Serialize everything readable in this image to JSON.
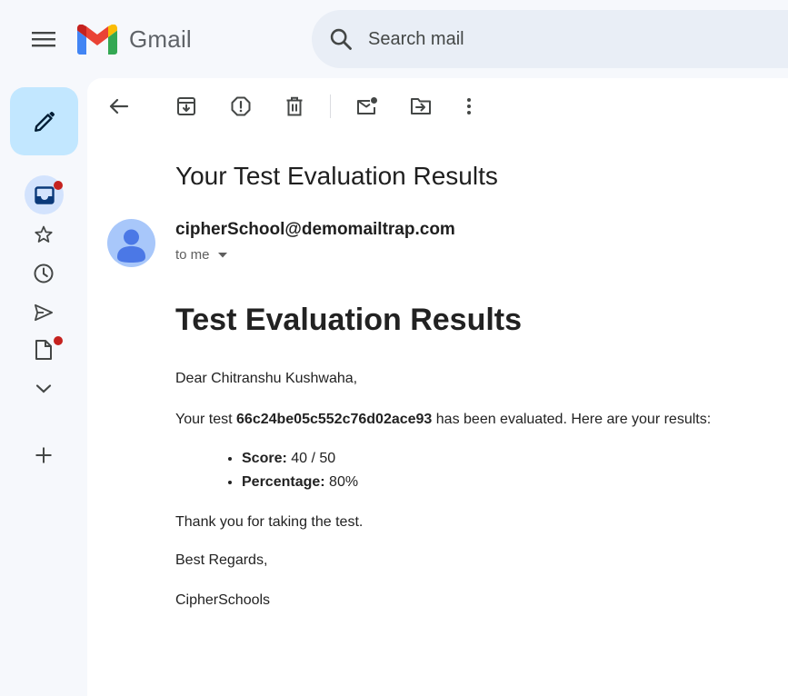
{
  "header": {
    "app_name": "Gmail",
    "search_placeholder": "Search mail"
  },
  "rail": {
    "items": [
      "inbox",
      "starred",
      "snoozed",
      "sent",
      "drafts",
      "more"
    ],
    "badge_color": "#c5221f"
  },
  "message": {
    "subject": "Your Test Evaluation Results",
    "sender": "cipherSchool@demomailtrap.com",
    "recipient_label": "to me"
  },
  "body": {
    "heading": "Test Evaluation Results",
    "greeting": "Dear Chitranshu Kushwaha,",
    "intro_prefix": "Your test ",
    "test_id": "66c24be05c552c76d02ace93",
    "intro_suffix": " has been evaluated. Here are your results:",
    "results": [
      {
        "label": "Score:",
        "value": " 40 / 50"
      },
      {
        "label": "Percentage:",
        "value": " 80%"
      }
    ],
    "thanks": "Thank you for taking the test.",
    "regards": "Best Regards,",
    "signature": "CipherSchools"
  },
  "colors": {
    "background": "#f6f8fc",
    "compose": "#c2e7ff",
    "search": "#e9eef6",
    "avatar": "#a8c7fa"
  }
}
